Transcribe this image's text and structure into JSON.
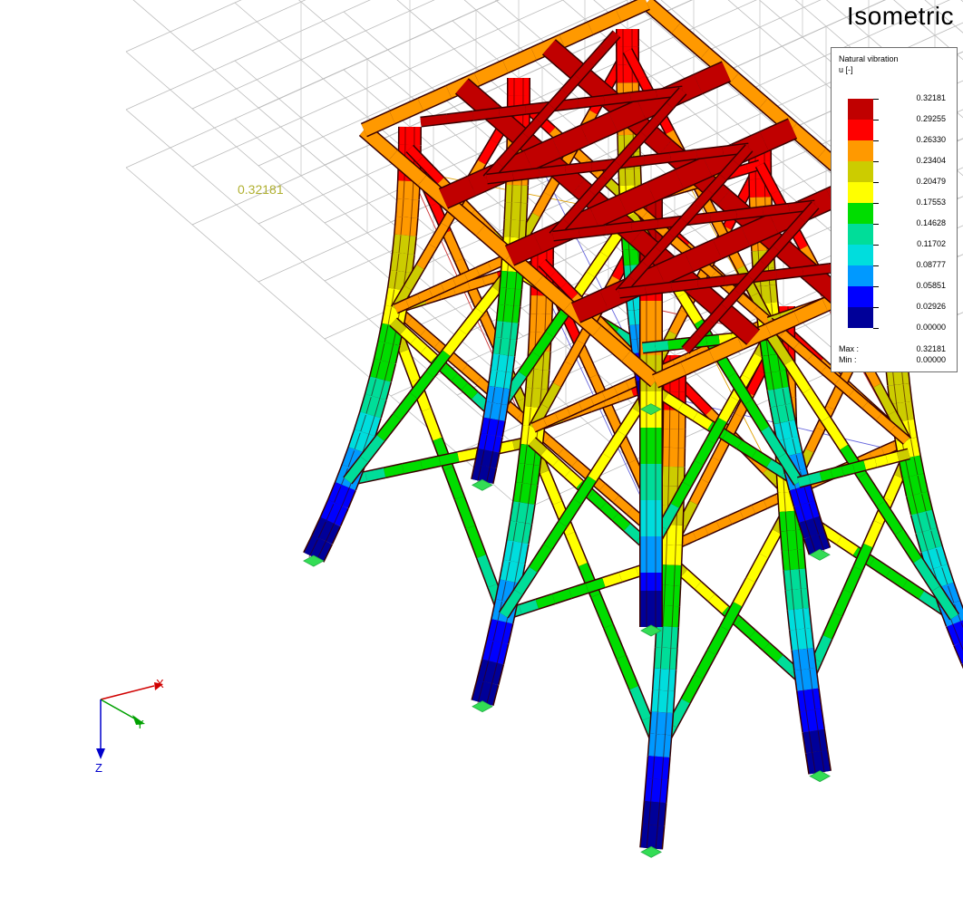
{
  "view": {
    "title": "Isometric"
  },
  "max_annotation": "0.32181",
  "legend": {
    "title_line1": "Natural vibration",
    "title_line2": "u [-]",
    "levels": [
      {
        "value": "0.32181",
        "color": "#c00000"
      },
      {
        "value": "0.29255",
        "color": "#ff0000"
      },
      {
        "value": "0.26330",
        "color": "#ff9900"
      },
      {
        "value": "0.23404",
        "color": "#cccc00"
      },
      {
        "value": "0.20479",
        "color": "#ffff00"
      },
      {
        "value": "0.17553",
        "color": "#00dd00"
      },
      {
        "value": "0.14628",
        "color": "#00dd99"
      },
      {
        "value": "0.11702",
        "color": "#00dddd"
      },
      {
        "value": "0.08777",
        "color": "#0099ff"
      },
      {
        "value": "0.05851",
        "color": "#0000ff"
      },
      {
        "value": "0.02926",
        "color": "#000099"
      },
      {
        "value": "0.00000",
        "color": null
      }
    ],
    "max_label": "Max :",
    "max_value": "0.32181",
    "min_label": "Min :",
    "min_value": "0.00000"
  },
  "axes": {
    "x_label": "X",
    "y_label": "Y",
    "z_label": "Z",
    "x_color": "#d00000",
    "y_color": "#00a000",
    "z_color": "#0000cc"
  }
}
